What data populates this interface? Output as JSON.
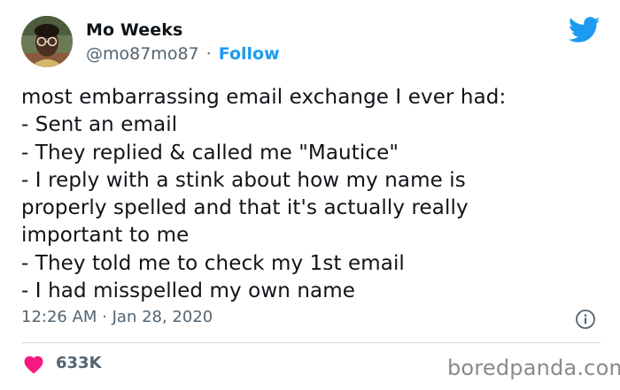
{
  "author": {
    "name": "Mo Weeks",
    "handle": "@mo87mo87",
    "separator": "·",
    "follow_label": "Follow",
    "avatar_icon": "avatar-photo"
  },
  "tweet": {
    "lines": [
      "most embarrassing email exchange I ever had:",
      "- Sent an email",
      "- They replied & called me \"Mautice\"",
      "- I reply with a stink about how my name is",
      "properly spelled and that it's actually really",
      "important to me",
      "- They told me to check my 1st email",
      "- I had misspelled my own name"
    ],
    "timestamp": "12:26 AM · Jan 28, 2020"
  },
  "engagement": {
    "likes": "633K",
    "heart_color": "#f91880"
  },
  "brand": {
    "twitter_color": "#1d9bf0",
    "watermark": "boredpanda.com"
  }
}
